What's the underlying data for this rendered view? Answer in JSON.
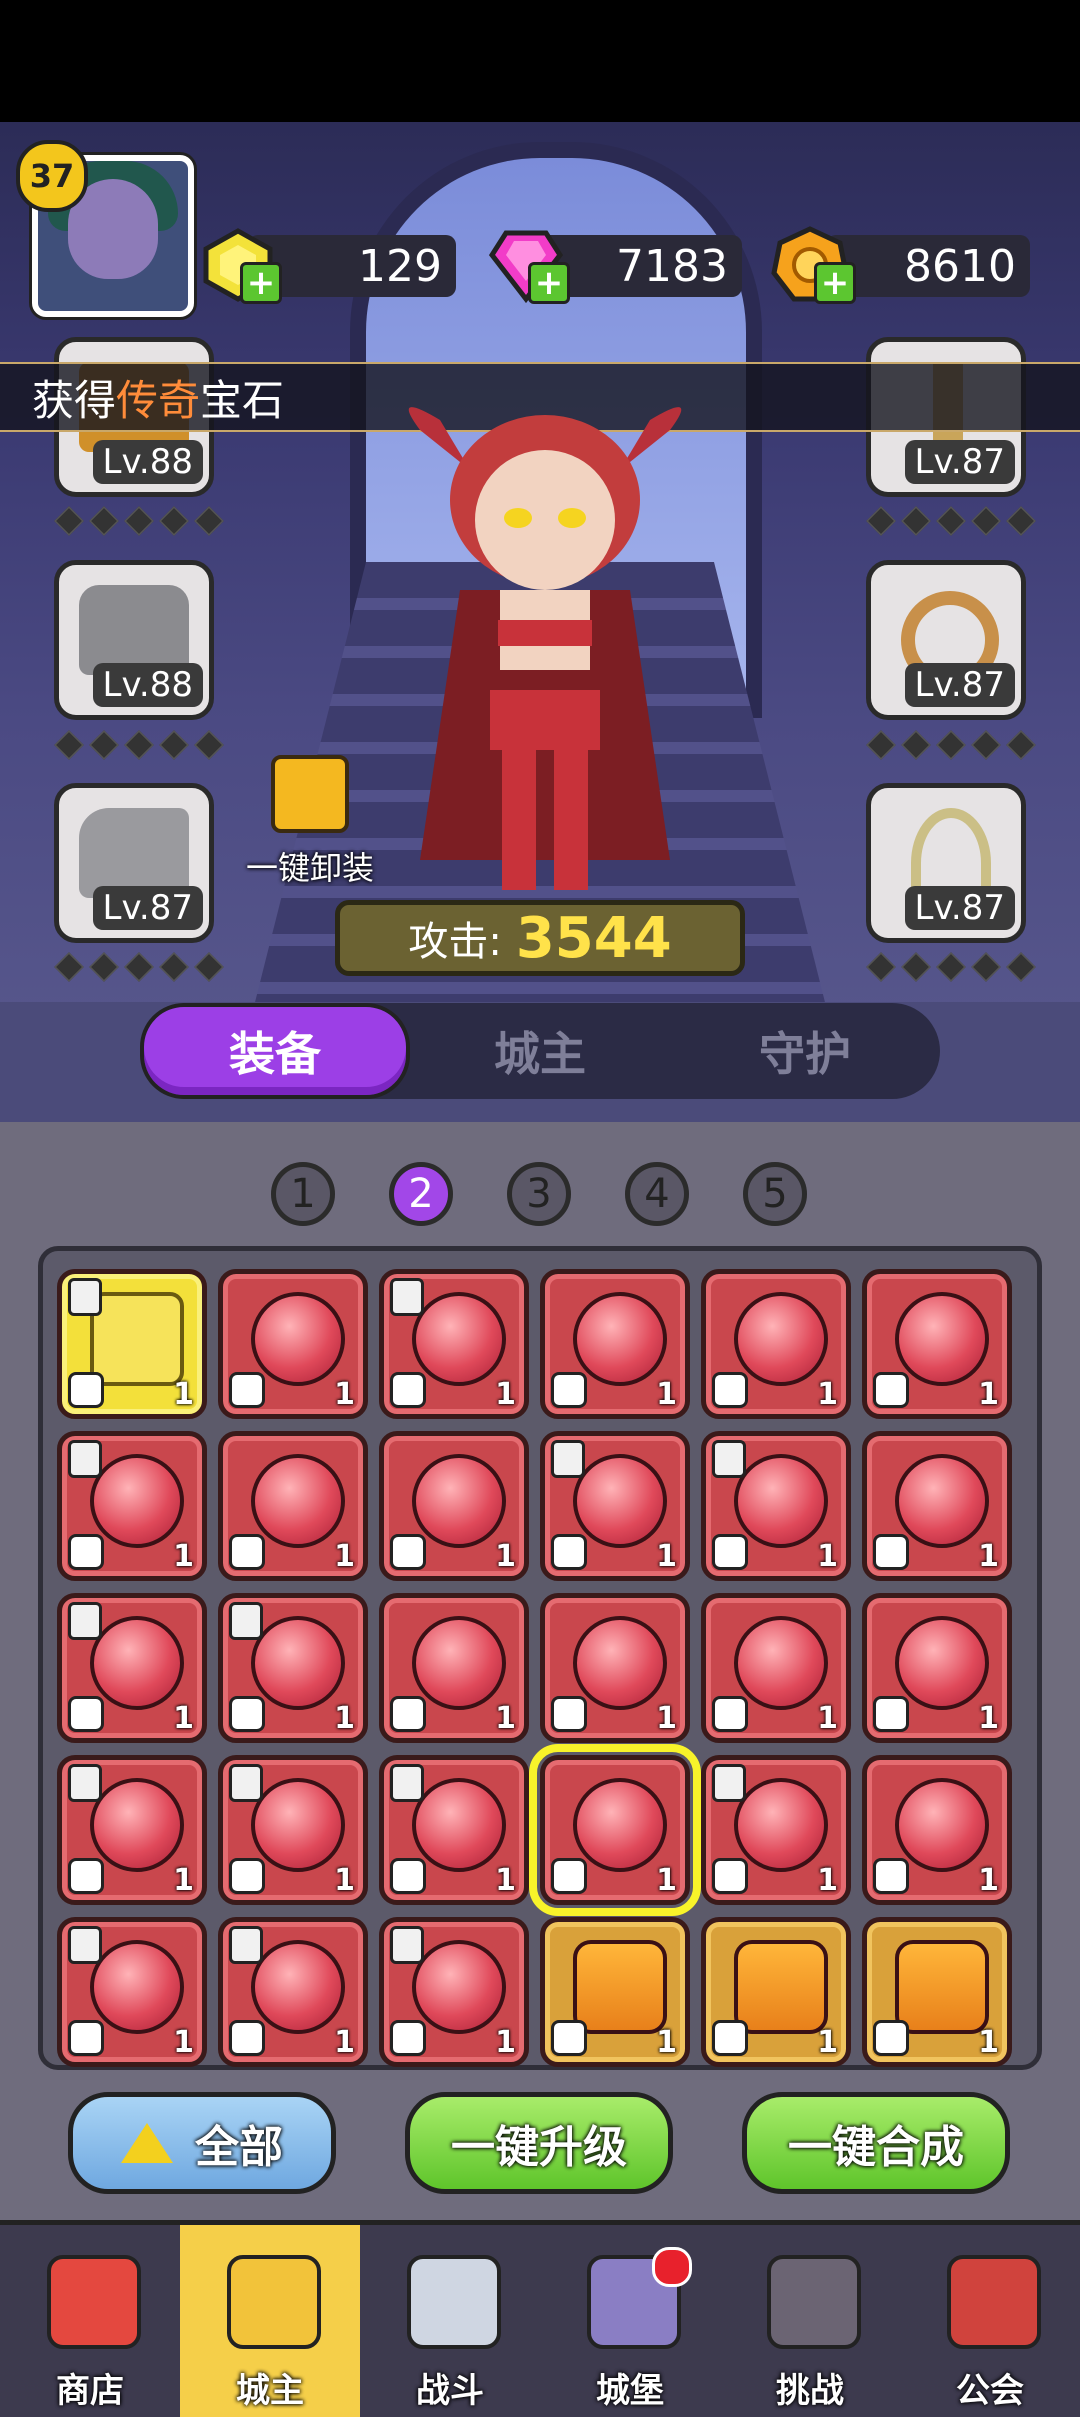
{
  "player": {
    "level": "37"
  },
  "currencies": [
    {
      "name": "gold-gem",
      "value": "129",
      "color": "#f3e23a"
    },
    {
      "name": "pink-crystal",
      "value": "7183",
      "color": "#f23cc8"
    },
    {
      "name": "gold-coin",
      "value": "8610",
      "color": "#f6a21c"
    }
  ],
  "notice": {
    "prefix": "获得",
    "highlight": "传奇",
    "suffix": "宝石"
  },
  "equipment_slots": [
    {
      "side": "left",
      "icon": "chest-icon",
      "level": "Lv.88"
    },
    {
      "side": "left",
      "icon": "armor-icon",
      "level": "Lv.88"
    },
    {
      "side": "left",
      "icon": "boot-icon",
      "level": "Lv.87"
    },
    {
      "side": "right",
      "icon": "staff-icon",
      "level": "Lv.87"
    },
    {
      "side": "right",
      "icon": "ring-icon",
      "level": "Lv.87"
    },
    {
      "side": "right",
      "icon": "necklace-icon",
      "level": "Lv.87"
    }
  ],
  "unequip": {
    "label": "一键卸装"
  },
  "attack": {
    "label": "攻击:",
    "value": "3544"
  },
  "tabs": [
    {
      "label": "装备",
      "active": true
    },
    {
      "label": "城主",
      "active": false
    },
    {
      "label": "守护",
      "active": false
    }
  ],
  "pages": [
    {
      "label": "1",
      "active": false
    },
    {
      "label": "2",
      "active": true
    },
    {
      "label": "3",
      "active": false
    },
    {
      "label": "4",
      "active": false
    },
    {
      "label": "5",
      "active": false
    }
  ],
  "gems": [
    {
      "kind": "yellow",
      "locked": true,
      "type": "ring",
      "count": "1"
    },
    {
      "kind": "red",
      "locked": false,
      "type": "crown",
      "count": "1"
    },
    {
      "kind": "red",
      "locked": true,
      "type": "crown",
      "count": "1"
    },
    {
      "kind": "red",
      "locked": false,
      "type": "crown",
      "count": "1"
    },
    {
      "kind": "red",
      "locked": false,
      "type": "crown",
      "count": "1"
    },
    {
      "kind": "red",
      "locked": false,
      "type": "crown",
      "count": "1"
    },
    {
      "kind": "red",
      "locked": true,
      "type": "armor",
      "count": "1"
    },
    {
      "kind": "red",
      "locked": false,
      "type": "armor",
      "count": "1"
    },
    {
      "kind": "red",
      "locked": false,
      "type": "armor",
      "count": "1"
    },
    {
      "kind": "red",
      "locked": true,
      "type": "armor",
      "count": "1"
    },
    {
      "kind": "red",
      "locked": true,
      "type": "armor",
      "count": "1"
    },
    {
      "kind": "red",
      "locked": false,
      "type": "armor",
      "count": "1"
    },
    {
      "kind": "red",
      "locked": true,
      "type": "boot",
      "count": "1"
    },
    {
      "kind": "red",
      "locked": true,
      "type": "boot",
      "count": "1"
    },
    {
      "kind": "red",
      "locked": false,
      "type": "boot",
      "count": "1"
    },
    {
      "kind": "red",
      "locked": false,
      "type": "boot",
      "count": "1"
    },
    {
      "kind": "red",
      "locked": false,
      "type": "boot",
      "count": "1"
    },
    {
      "kind": "red",
      "locked": false,
      "type": "staff",
      "count": "1"
    },
    {
      "kind": "red",
      "locked": true,
      "type": "staff",
      "count": "1"
    },
    {
      "kind": "red",
      "locked": true,
      "type": "staff",
      "count": "1"
    },
    {
      "kind": "red",
      "locked": true,
      "type": "staff",
      "count": "1"
    },
    {
      "kind": "red",
      "locked": false,
      "type": "necklace",
      "count": "1",
      "selected": true
    },
    {
      "kind": "red",
      "locked": true,
      "type": "necklace",
      "count": "1"
    },
    {
      "kind": "red",
      "locked": false,
      "type": "necklace",
      "count": "1"
    },
    {
      "kind": "red",
      "locked": true,
      "type": "necklace",
      "count": "1"
    },
    {
      "kind": "red",
      "locked": true,
      "type": "necklace",
      "count": "1"
    },
    {
      "kind": "red",
      "locked": true,
      "type": "necklace",
      "count": "1"
    },
    {
      "kind": "orange",
      "locked": false,
      "type": "crown",
      "count": "1"
    },
    {
      "kind": "orange",
      "locked": false,
      "type": "crown",
      "count": "1"
    },
    {
      "kind": "orange",
      "locked": false,
      "type": "crown",
      "count": "1"
    }
  ],
  "actions": {
    "all": "全部",
    "upgrade": "一键升级",
    "merge": "一键合成"
  },
  "nav": [
    {
      "label": "商店",
      "icon": "shop-icon",
      "active": false,
      "dot": false
    },
    {
      "label": "城主",
      "icon": "crown-icon",
      "active": true,
      "dot": false
    },
    {
      "label": "战斗",
      "icon": "swords-icon",
      "active": false,
      "dot": false
    },
    {
      "label": "城堡",
      "icon": "castle-icon",
      "active": false,
      "dot": true
    },
    {
      "label": "挑战",
      "icon": "demon-icon",
      "active": false,
      "dot": false
    },
    {
      "label": "公会",
      "icon": "banner-icon",
      "active": false,
      "dot": false
    }
  ]
}
